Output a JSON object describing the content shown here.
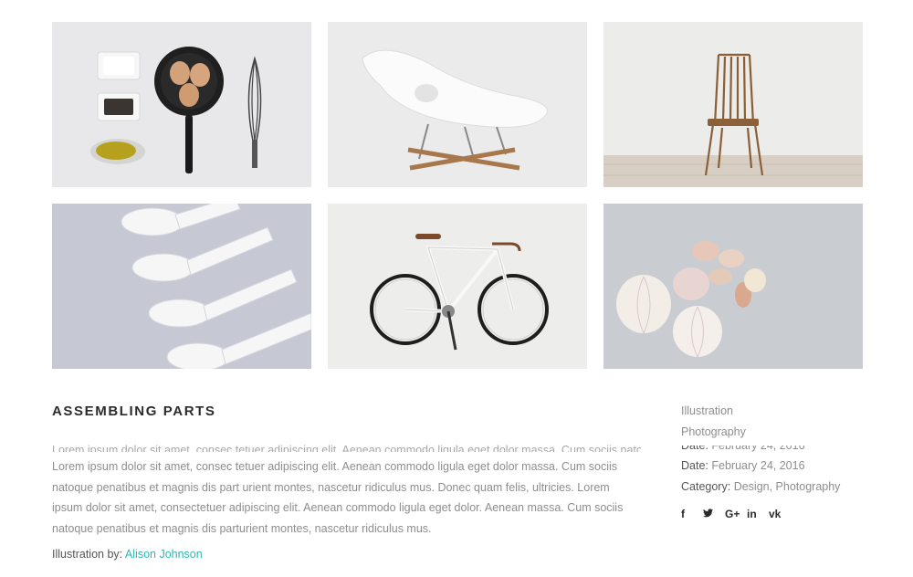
{
  "gallery": {
    "images": [
      {
        "name": "kitchen-items"
      },
      {
        "name": "white-lounge-chair"
      },
      {
        "name": "wooden-chair"
      },
      {
        "name": "white-spoons"
      },
      {
        "name": "white-bicycle"
      },
      {
        "name": "garlic-cloves"
      }
    ]
  },
  "project": {
    "title": "ASSEMBLING PARTS",
    "ghost_line": "Lorem ipsum dolor sit amet, consec tetuer adipiscing elit. Aenean commodo ligula eget dolor massa. Cum sociis natoque",
    "paragraph": "Lorem ipsum dolor sit amet, consec tetuer adipiscing elit. Aenean commodo ligula eget dolor massa. Cum sociis natoque penatibus et magnis dis part urient montes, nascetur ridiculus mus. Donec quam felis, ultricies. Lorem ipsum dolor sit amet, consectetuer adipiscing elit. Aenean commodo ligula eget dolor. Aenean massa. Cum sociis natoque penatibus et magnis dis parturient montes, nascetur ridiculus mus.",
    "credit_label": "Illustration by:",
    "credit_name": "Alison Johnson"
  },
  "meta": {
    "tag1": "Illustration",
    "tag2": "Photography",
    "date_label": "Date:",
    "date_value": "February 24, 2016",
    "category_label": "Category:",
    "category_value": "Design, Photography"
  },
  "social": {
    "facebook": "f",
    "twitter": "🐦",
    "googleplus": "G+",
    "linkedin": "in",
    "vk": "vk"
  },
  "colors": {
    "accent": "#2fb8b0",
    "heading": "#2b2b2b",
    "text": "#8e8e8e"
  }
}
